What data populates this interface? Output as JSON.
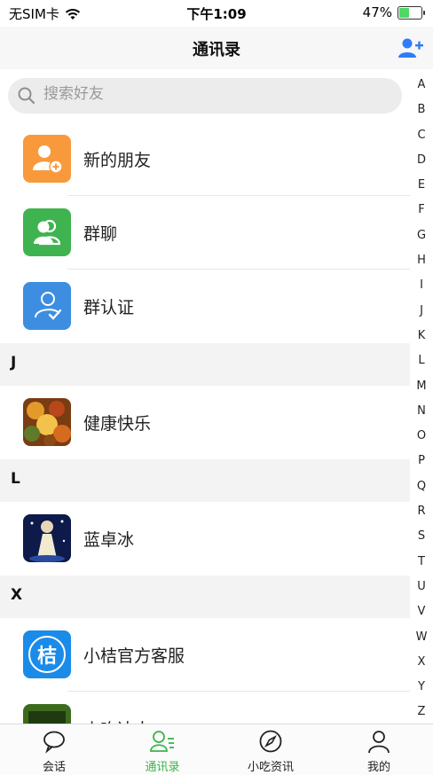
{
  "status_bar": {
    "carrier": "无SIM卡",
    "time": "下午1:09",
    "battery_percent": "47%",
    "battery_level": 0.47,
    "wifi_icon": "wifi-icon",
    "battery_icon": "battery-charging-icon"
  },
  "nav": {
    "title": "通讯录",
    "add_icon": "add-contact-icon",
    "accent_color": "#2f7cf6"
  },
  "search": {
    "placeholder": "搜索好友",
    "icon": "search-icon"
  },
  "special_entries": [
    {
      "label": "新的朋友",
      "icon": "new-friend-icon",
      "color": "#f89a3c"
    },
    {
      "label": "群聊",
      "icon": "group-chat-icon",
      "color": "#3fb34f"
    },
    {
      "label": "群认证",
      "icon": "group-verify-icon",
      "color": "#3d8ee0"
    }
  ],
  "sections": [
    {
      "letter": "J",
      "contacts": [
        {
          "name": "健康快乐"
        }
      ]
    },
    {
      "letter": "L",
      "contacts": [
        {
          "name": "蓝卓冰"
        }
      ]
    },
    {
      "letter": "X",
      "contacts": [
        {
          "name": "小桔官方客服",
          "avatar_text": "桔"
        },
        {
          "name": "小吃达人"
        }
      ]
    }
  ],
  "alpha_index": [
    "A",
    "B",
    "C",
    "D",
    "E",
    "F",
    "G",
    "H",
    "I",
    "J",
    "K",
    "L",
    "M",
    "N",
    "O",
    "P",
    "Q",
    "R",
    "S",
    "T",
    "U",
    "V",
    "W",
    "X",
    "Y",
    "Z"
  ],
  "tabs": [
    {
      "label": "会话",
      "icon": "chat-bubble-icon",
      "active": false
    },
    {
      "label": "通讯录",
      "icon": "contacts-icon",
      "active": true
    },
    {
      "label": "小吃资讯",
      "icon": "compass-icon",
      "active": false
    },
    {
      "label": "我的",
      "icon": "profile-icon",
      "active": false
    }
  ],
  "colors": {
    "active_tab": "#39b54a",
    "section_bg": "#f3f3f3"
  }
}
